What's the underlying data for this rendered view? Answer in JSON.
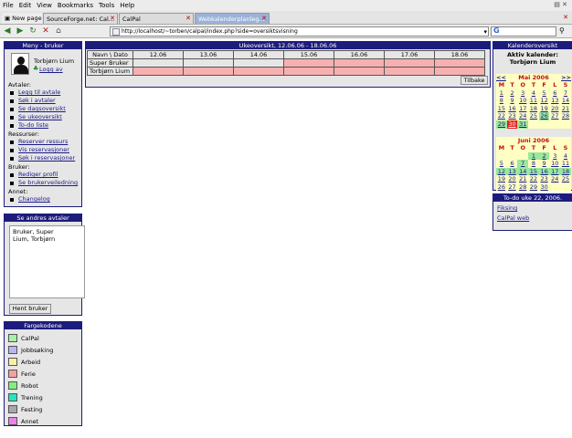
{
  "browser": {
    "menu": [
      "File",
      "Edit",
      "View",
      "Bookmarks",
      "Tools",
      "Help"
    ],
    "tabs": [
      "New page",
      "SourceForge.net: Cal...",
      "CalPal",
      "Webkalenderplanleg..."
    ],
    "url": "http://localhost/~torben/calpal/index.php?side=oversiktsvisning",
    "search_icon_label": "G"
  },
  "menu_panel": {
    "title": "Meny - bruker",
    "user_name": "Torbjørn Lium",
    "logout": "Logg av",
    "sections": [
      {
        "heading": "Avtaler:",
        "links": [
          "Legg til avtale",
          "Søk i avtaler",
          "Se dagsoversikt",
          "Se ukeoversikt",
          "To-do liste"
        ]
      },
      {
        "heading": "Ressurser:",
        "links": [
          "Reserver ressurs",
          "Vis reservasjoner",
          "Søk i reservasjoner"
        ]
      },
      {
        "heading": "Bruker:",
        "links": [
          "Rediger profil",
          "Se brukerveiledning"
        ]
      },
      {
        "heading": "Annet:",
        "links": [
          "Changelog"
        ]
      }
    ]
  },
  "others_panel": {
    "title": "Se andres avtaler",
    "users": [
      "Bruker, Super",
      "Lium, Torbjørn"
    ],
    "button": "Hent bruker"
  },
  "color_panel": {
    "title": "Fargekodene",
    "items": [
      {
        "label": "CalPal",
        "color": "#a8f0a8"
      },
      {
        "label": "Jobbsøking",
        "color": "#b8b8f0"
      },
      {
        "label": "Arbeid",
        "color": "#f8f0a8"
      },
      {
        "label": "Ferie",
        "color": "#f4a0a0"
      },
      {
        "label": "Robot",
        "color": "#80f080"
      },
      {
        "label": "Trening",
        "color": "#20e8c0"
      },
      {
        "label": "Festing",
        "color": "#a8a8a8"
      },
      {
        "label": "Annet",
        "color": "#f080f0"
      }
    ]
  },
  "week_view": {
    "title": "Ukeoversikt, 12.06.06 - 18.06.06",
    "corner": "Navn  \\ Dato",
    "dates": [
      "12.06",
      "13.06",
      "14.06",
      "15.06",
      "16.06",
      "17.06",
      "18.06"
    ],
    "rows": [
      {
        "name": "Super Bruker",
        "busy": [
          false,
          false,
          false,
          true,
          true,
          true,
          true
        ]
      },
      {
        "name": "Torbjørn Lium",
        "busy": [
          false,
          false,
          false,
          false,
          false,
          false,
          false
        ]
      }
    ],
    "back_button": "Tilbake"
  },
  "calendar": {
    "title": "Kalenderoversikt",
    "active_label": "Aktiv kalender:",
    "active_user": "Torbjørn Lium",
    "weekdays": [
      "M",
      "T",
      "O",
      "T",
      "F",
      "L",
      "S"
    ],
    "months": [
      {
        "name": "Mai 2006",
        "prev": "<<",
        "next": ">>",
        "days": [
          "1",
          "2",
          "3",
          "4",
          "5",
          "6",
          "7",
          "8",
          "9",
          "10",
          "11",
          "12",
          "13",
          "14",
          "15",
          "16",
          "17",
          "18",
          "19",
          "20",
          "21",
          "22",
          "23",
          "24",
          "25",
          "26",
          "27",
          "28",
          "29",
          "30",
          "31"
        ],
        "lead_blanks": 0,
        "highlight": [
          "26",
          "29"
        ],
        "today": "30",
        "green_after": [
          "31"
        ]
      },
      {
        "name": "Juni 2006",
        "prev": "",
        "next": "",
        "days": [
          "1",
          "2",
          "3",
          "4",
          "5",
          "6",
          "7",
          "8",
          "9",
          "10",
          "11",
          "12",
          "13",
          "14",
          "15",
          "16",
          "17",
          "18",
          "19",
          "20",
          "21",
          "22",
          "23",
          "24",
          "25",
          "26",
          "27",
          "28",
          "29",
          "30"
        ],
        "lead_blanks": 3,
        "highlight": [
          "1",
          "2",
          "7",
          "12",
          "13",
          "14",
          "15",
          "16",
          "17",
          "18"
        ],
        "today": "",
        "green_after": []
      }
    ]
  },
  "todo_panel": {
    "title": "To-do uke 22, 2006.",
    "items": [
      "Fiksing",
      "CalPal web"
    ]
  }
}
